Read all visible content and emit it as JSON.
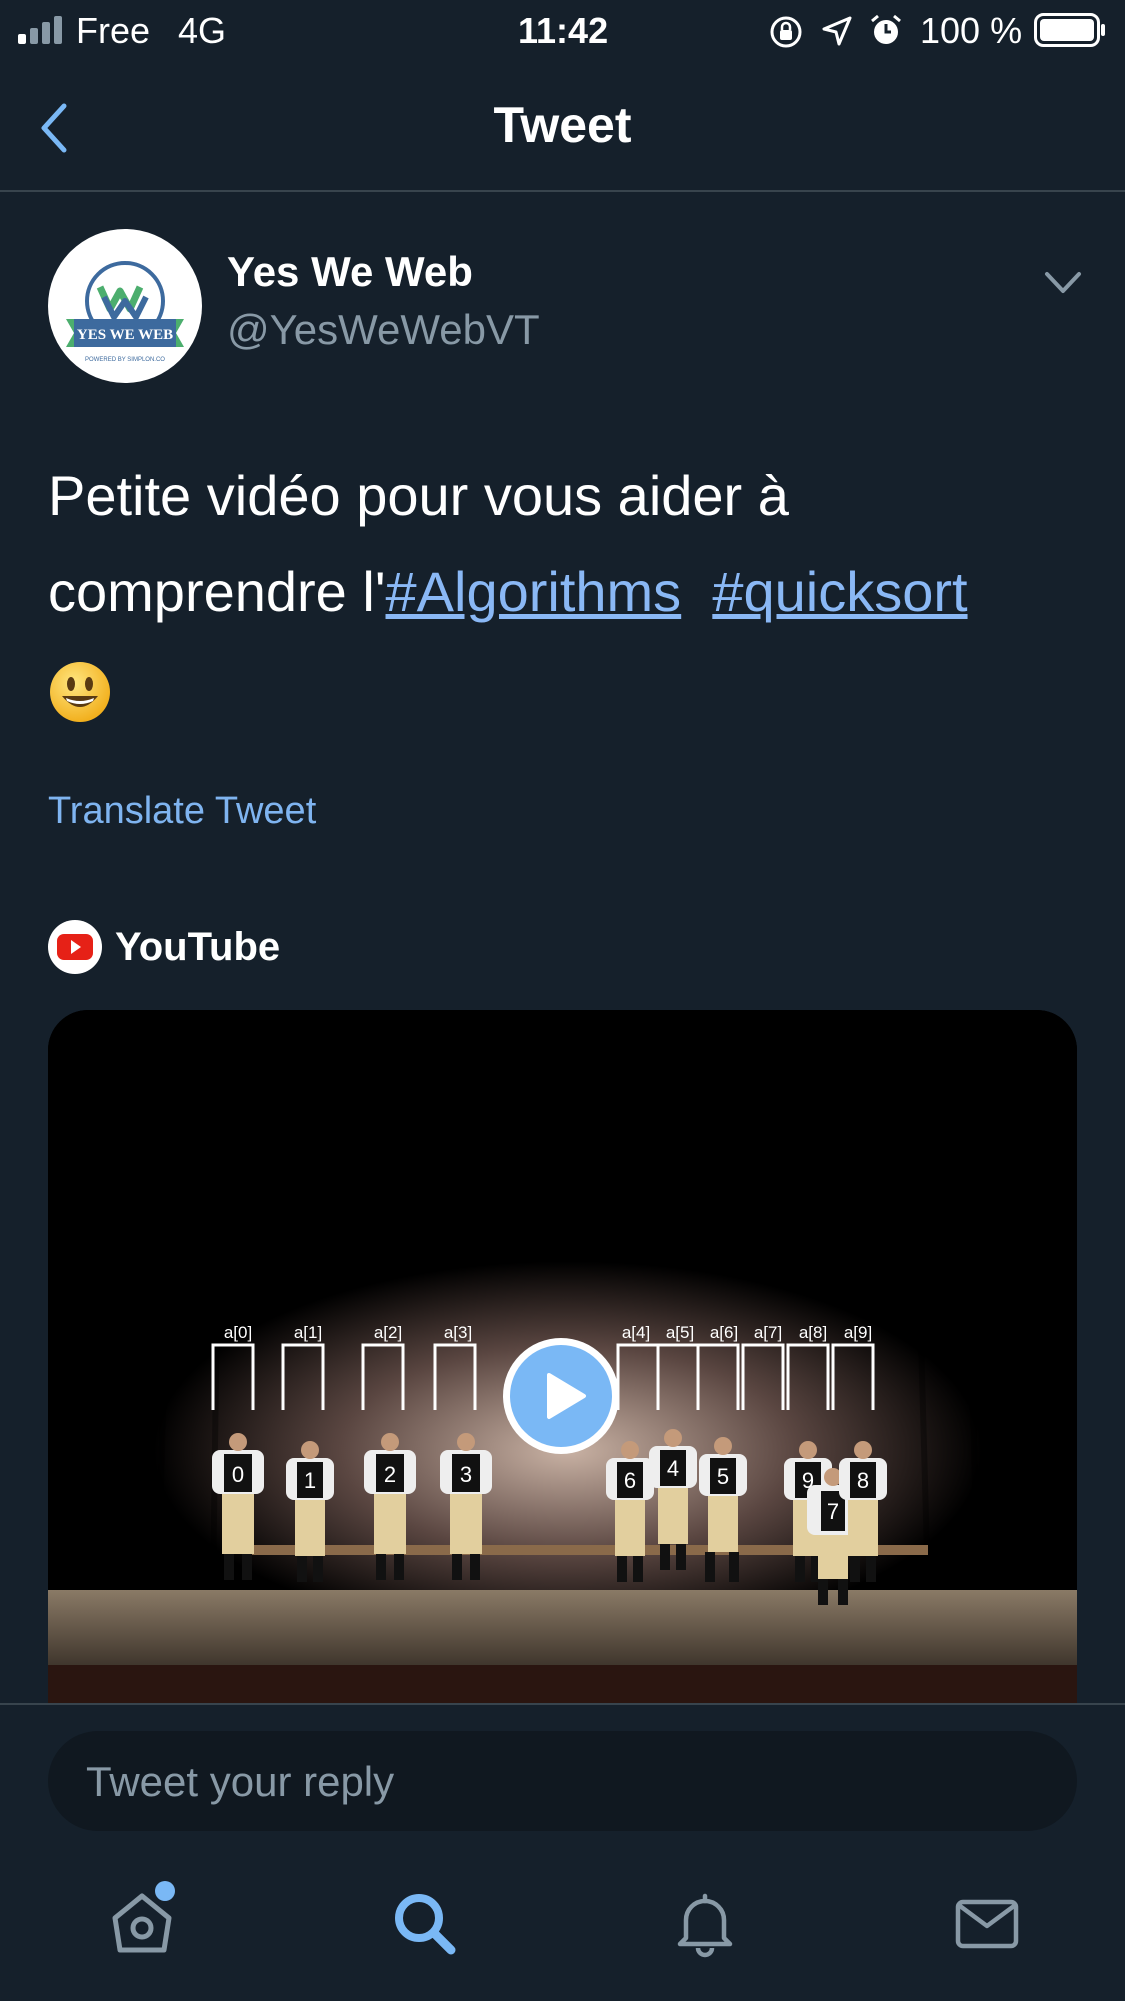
{
  "status_bar": {
    "carrier": "Free",
    "network": "4G",
    "time": "11:42",
    "battery": "100 %"
  },
  "header": {
    "title": "Tweet",
    "back_icon": "chevron-left-icon"
  },
  "tweet": {
    "author_name": "Yes We Web",
    "author_handle": "@YesWeWebVT",
    "avatar_text": "YES WE WEB",
    "avatar_subtext": "POWERED BY SIMPLON.CO",
    "text_part1": "Petite vidéo pour vous aider à comprendre l'",
    "hashtag1": "#Algorithms",
    "hashtag2": "#quicksort",
    "emoji": "smiley-emoji",
    "translate_label": "Translate Tweet"
  },
  "media": {
    "source": "YouTube",
    "video_labels": [
      "a[0]",
      "a[1]",
      "a[2]",
      "a[3]",
      "a[4]",
      "a[5]",
      "a[6]",
      "a[7]",
      "a[8]",
      "a[9]"
    ],
    "dancer_numbers": [
      "0",
      "1",
      "2",
      "3",
      "6",
      "4",
      "5",
      "9",
      "7",
      "8"
    ]
  },
  "reply": {
    "placeholder": "Tweet your reply"
  },
  "tabbar": {
    "items": [
      "home-icon",
      "search-icon",
      "notifications-icon",
      "messages-icon"
    ]
  },
  "colors": {
    "background": "#15202b",
    "accent": "#7ab8f5",
    "secondary_text": "#8899a6",
    "divider": "#38444d"
  }
}
